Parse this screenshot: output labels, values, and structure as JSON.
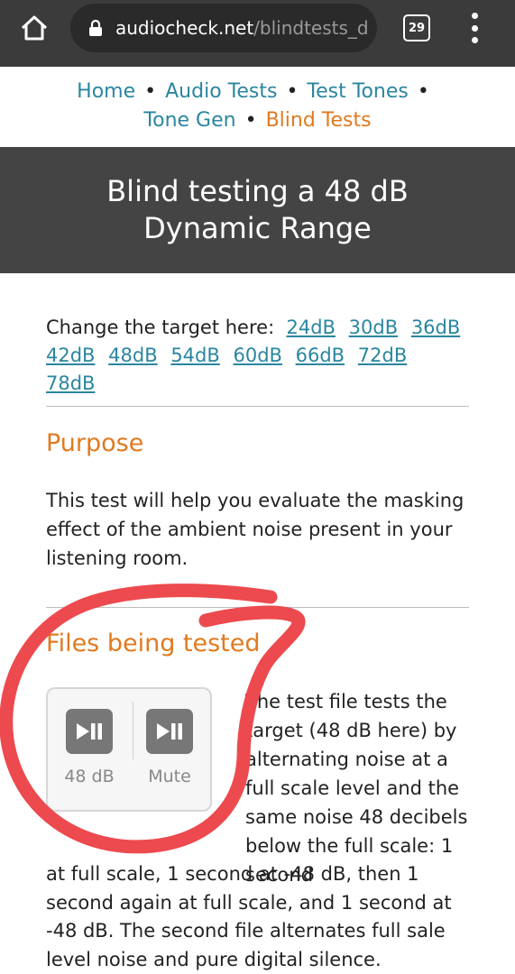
{
  "browser": {
    "url_host": "audiocheck.net",
    "url_path": "/blindtests_d",
    "tab_count": "29"
  },
  "nav": {
    "items": [
      "Home",
      "Audio Tests",
      "Test Tones",
      "Tone Gen",
      "Blind Tests"
    ],
    "current": "Blind Tests"
  },
  "page": {
    "title": "Blind testing a 48 dB Dynamic Range",
    "change_target_label": "Change the target here:",
    "targets": [
      "24dB",
      "30dB",
      "36dB",
      "42dB",
      "48dB",
      "54dB",
      "60dB",
      "66dB",
      "72dB",
      "78dB"
    ]
  },
  "purpose": {
    "heading": "Purpose",
    "text": "This test will help you evaluate the masking effect of the ambient noise present in your listening room."
  },
  "files": {
    "heading": "Files being tested",
    "player": [
      {
        "label": "48 dB",
        "icon": "play-pause-icon"
      },
      {
        "label": "Mute",
        "icon": "play-pause-icon"
      }
    ],
    "text_right": "The test file tests the target (48 dB here) by alternating noise at a full scale level and the same noise 48 decibels below the full scale: 1 second",
    "text_bottom": "at full scale, 1 second at -48 dB, then 1 second again at full scale, and 1 second at -48 dB. The second file alternates full sale level noise and pure digital silence."
  },
  "colors": {
    "link": "#2a86a0",
    "accent": "#e07a1f",
    "title_band": "#444444",
    "annotation": "#ec4a4e"
  }
}
